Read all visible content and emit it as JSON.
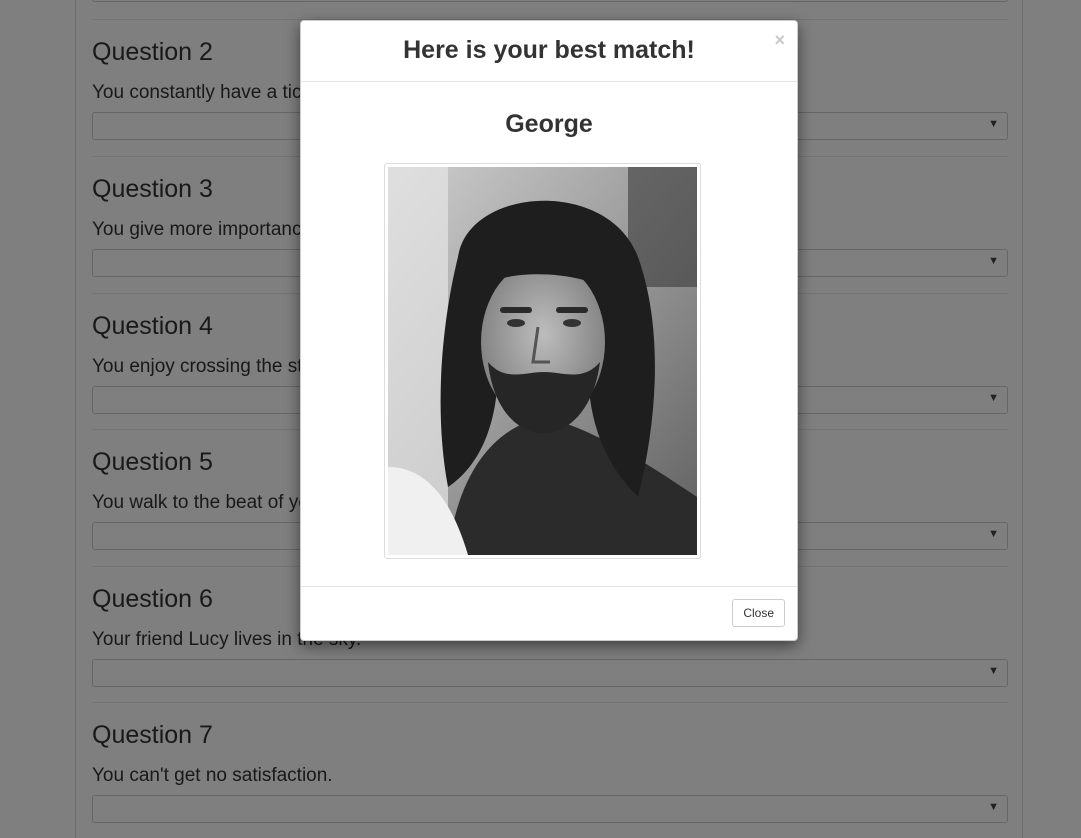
{
  "questions": [
    {
      "title": "Question 2",
      "text": "You constantly have a ticket to ride."
    },
    {
      "title": "Question 3",
      "text": "You give more importance to love than money."
    },
    {
      "title": "Question 4",
      "text": "You enjoy crossing the street."
    },
    {
      "title": "Question 5",
      "text": "You walk to the beat of your own drum."
    },
    {
      "title": "Question 6",
      "text": "Your friend Lucy lives in the sky."
    },
    {
      "title": "Question 7",
      "text": "You can't get no satisfaction."
    }
  ],
  "select_caret": "▼",
  "modal": {
    "title": "Here is your best match!",
    "close_x": "×",
    "match_name": "George",
    "photo_alt": "George",
    "close_button": "Close"
  }
}
